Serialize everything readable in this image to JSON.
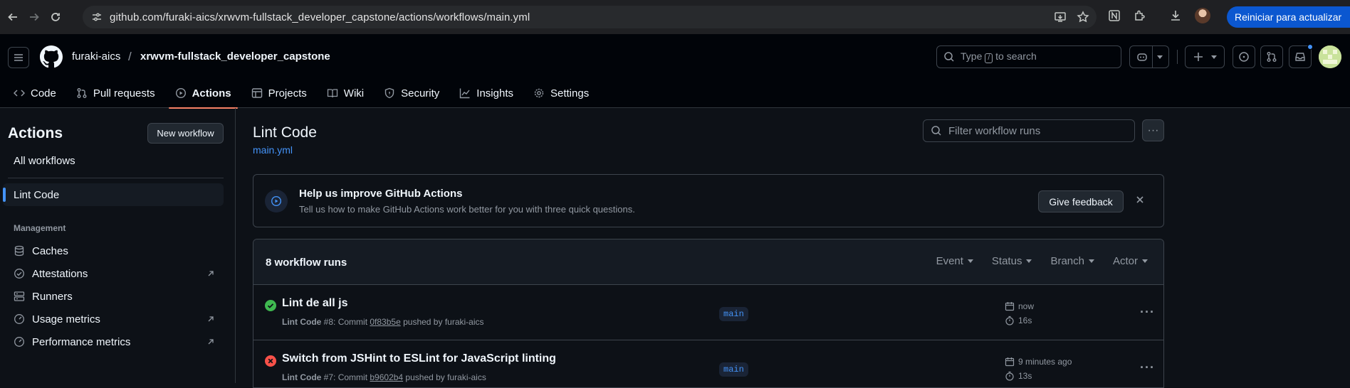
{
  "browser": {
    "url": "github.com/furaki-aics/xrwvm-fullstack_developer_capstone/actions/workflows/main.yml",
    "restart_label": "Reiniciar para actualizar",
    "icons": [
      "back-icon",
      "forward-icon",
      "reload-icon",
      "site-settings-icon",
      "install-icon",
      "bookmark-star-icon",
      "notion-extension-icon",
      "extensions-icon",
      "downloads-icon",
      "profile-avatar"
    ]
  },
  "header": {
    "owner": "furaki-aics",
    "separator": "/",
    "repo": "xrwvm-fullstack_developer_capstone",
    "search_pre": "Type",
    "search_key": "/",
    "search_post": "to search"
  },
  "repo_nav": {
    "tabs": [
      {
        "label": "Code",
        "icon": "code-icon"
      },
      {
        "label": "Pull requests",
        "icon": "pull-request-icon"
      },
      {
        "label": "Actions",
        "icon": "play-icon",
        "active": true
      },
      {
        "label": "Projects",
        "icon": "table-icon"
      },
      {
        "label": "Wiki",
        "icon": "book-icon"
      },
      {
        "label": "Security",
        "icon": "shield-icon"
      },
      {
        "label": "Insights",
        "icon": "graph-icon"
      },
      {
        "label": "Settings",
        "icon": "gear-icon"
      }
    ]
  },
  "sidebar": {
    "title": "Actions",
    "new_workflow": "New workflow",
    "all_workflows": "All workflows",
    "workflow": "Lint Code",
    "section": "Management",
    "items": [
      {
        "label": "Caches",
        "icon": "database-icon"
      },
      {
        "label": "Attestations",
        "icon": "verified-icon"
      },
      {
        "label": "Runners",
        "icon": "server-icon"
      },
      {
        "label": "Usage metrics",
        "icon": "meter-icon"
      },
      {
        "label": "Performance metrics",
        "icon": "meter-icon"
      }
    ]
  },
  "main": {
    "title": "Lint Code",
    "file": "main.yml",
    "filter_placeholder": "Filter workflow runs",
    "banner": {
      "title": "Help us improve GitHub Actions",
      "subtitle": "Tell us how to make GitHub Actions work better for you with three quick questions.",
      "button": "Give feedback"
    },
    "runs_count": "8 workflow runs",
    "filters": [
      "Event",
      "Status",
      "Branch",
      "Actor"
    ],
    "runs": [
      {
        "title": "Lint de all js",
        "status": "success",
        "workflow": "Lint Code",
        "run_number": "#8",
        "sha": "0f83b5e",
        "pushed_by": "furaki-aics",
        "branch": "main",
        "when": "now",
        "duration": "16s"
      },
      {
        "title": "Switch from JSHint to ESLint for JavaScript linting",
        "status": "failure",
        "workflow": "Lint Code",
        "run_number": "#7",
        "sha": "b9602b4",
        "pushed_by": "furaki-aics",
        "branch": "main",
        "when": "9 minutes ago",
        "duration": "13s"
      }
    ]
  },
  "colors": {
    "accent_blue": "#4493f8",
    "active_tab_underline": "#f78166",
    "success": "#3fb950",
    "failure": "#f85149",
    "restart_button": "#0b57d0"
  }
}
